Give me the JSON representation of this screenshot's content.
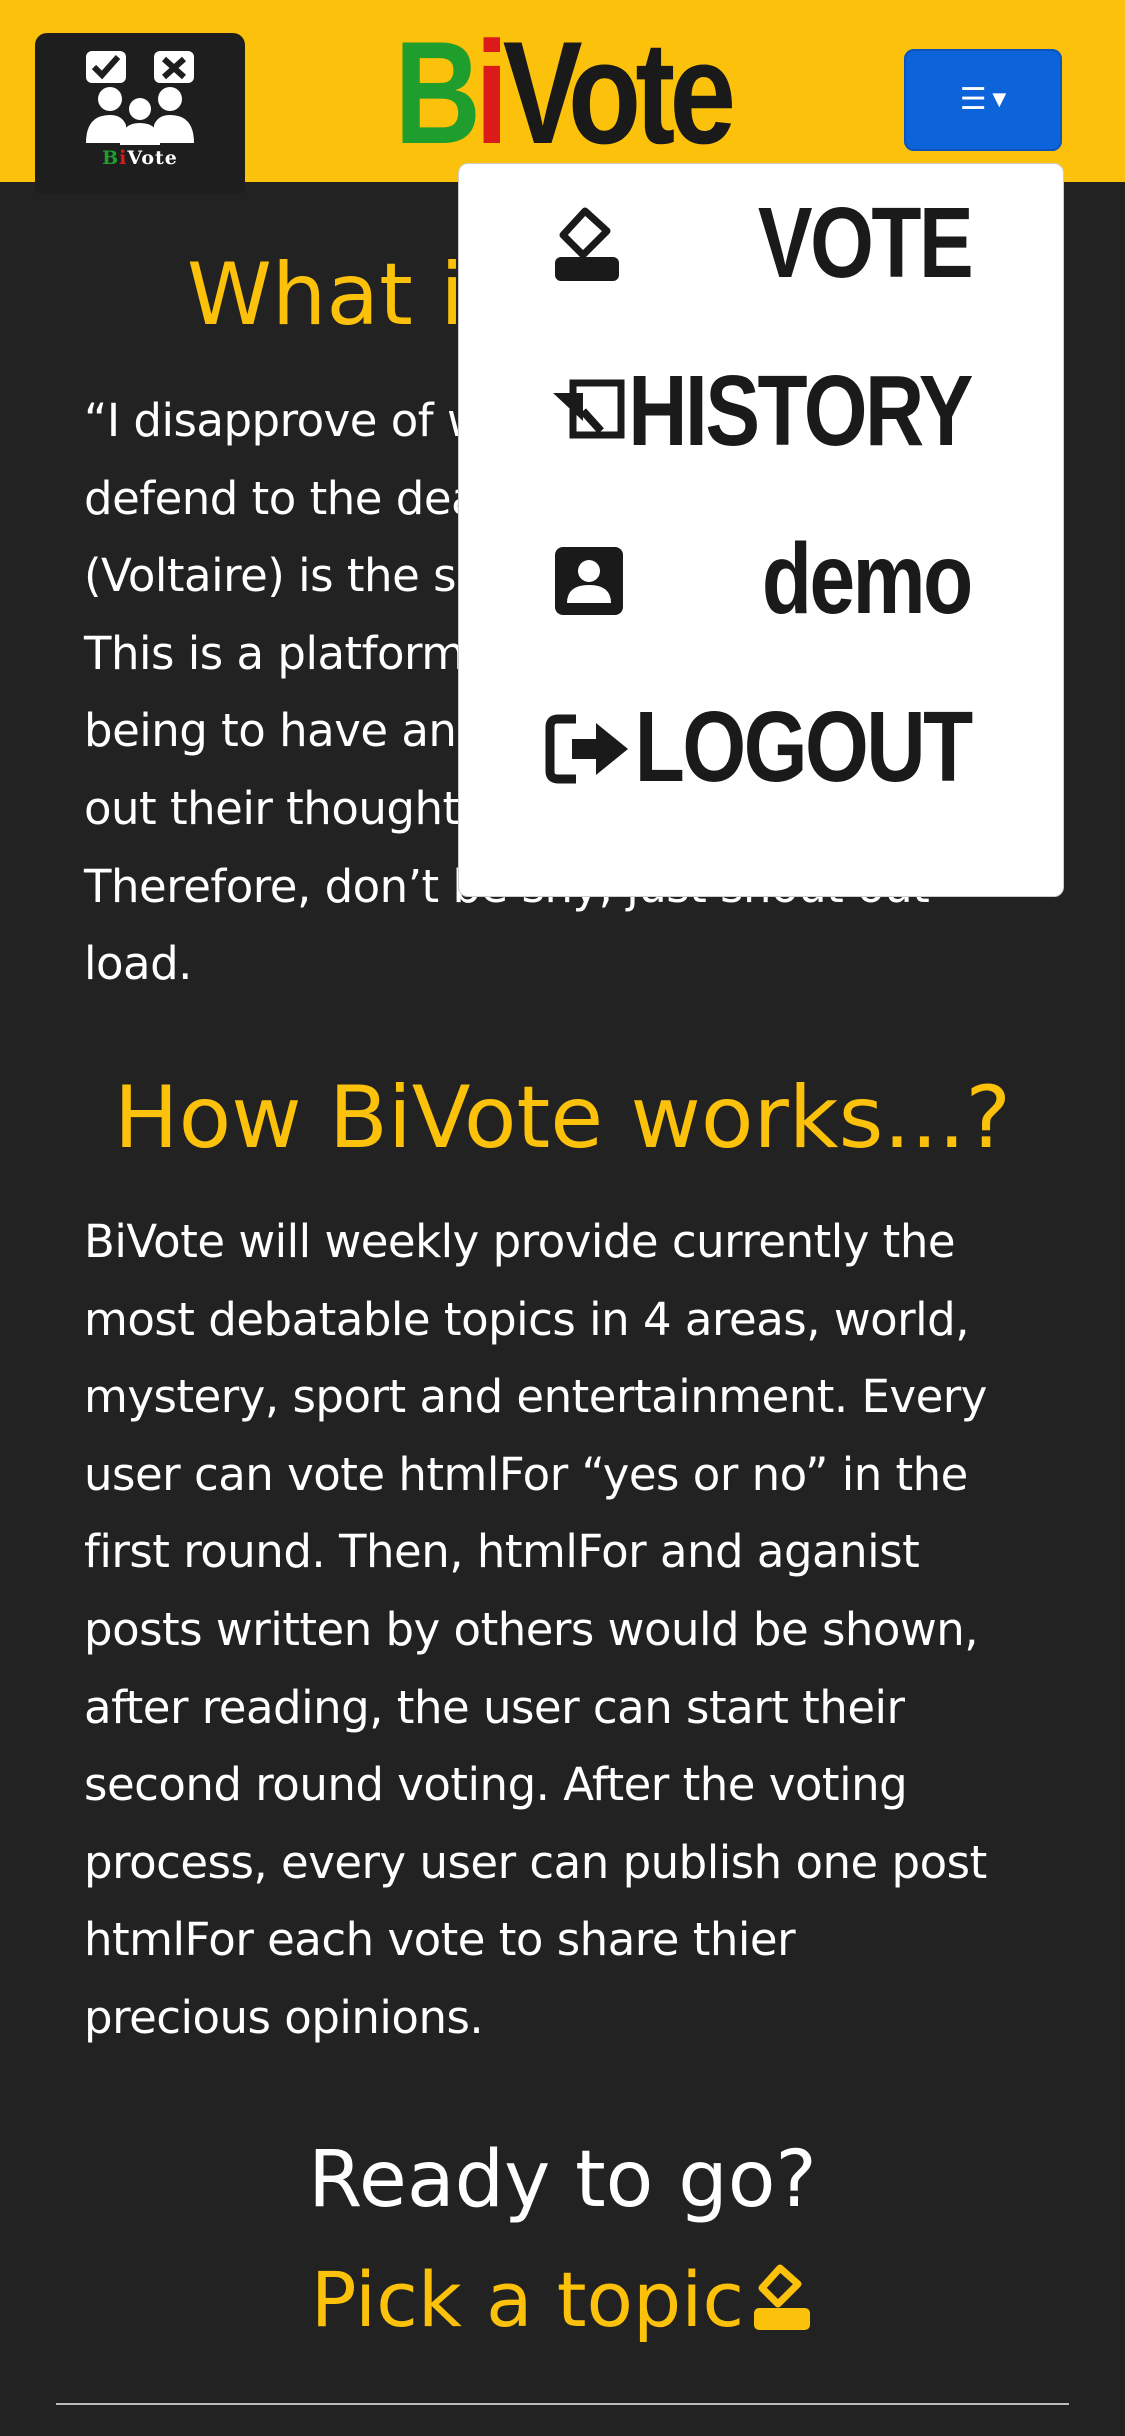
{
  "header": {
    "logo_mini_b": "B",
    "logo_mini_i": "i",
    "logo_mini_rest": "Vote",
    "brand_b": "B",
    "brand_i": "i",
    "brand_rest": "Vote",
    "menu_icon": "hamburger-icon",
    "colors": {
      "nav_bg": "#fcc10a",
      "toggler": "#0d63d9",
      "brand_green": "#1f9e2d",
      "brand_red": "#dd1a1a"
    }
  },
  "dropdown": {
    "items": [
      {
        "label": "VOTE",
        "icon": "ballot-box-icon"
      },
      {
        "label": "HISTORY",
        "icon": "history-icon"
      },
      {
        "label": "demo",
        "icon": "user-icon"
      },
      {
        "label": "LOGOUT",
        "icon": "logout-icon"
      }
    ]
  },
  "main": {
    "section1_heading": "What is BiVote...?",
    "section1_lines": [
      "“I disapprove of what you say, but I will",
      "defend to the death your right to say it”",
      "(Voltaire) is the spirit of BiVote.",
      "This is a platform that allows every human",
      "being to have an equal right to speak",
      "out their thoughts and opinions freely.",
      "Therefore, don’t be shy, just shout out",
      "load."
    ],
    "section2_heading": "How BiVote works...?",
    "section2_lines": [
      "BiVote will weekly provide currently the",
      "most debatable topics in 4 areas, world,",
      "mystery, sport and entertainment. Every",
      "user can vote htmlFor “yes or no” in the",
      "first round. Then, htmlFor and aganist",
      "posts written by others would be shown,",
      "after reading, the user can start their",
      "second round voting. After the voting",
      "process, every user can publish one post",
      "htmlFor each vote to share thier",
      "precious opinions."
    ],
    "ready_text": "Ready to go?",
    "pick_text": "Pick a topic",
    "pick_icon": "ballot-box-icon",
    "text_color": "#ffffff",
    "accent_color": "#fcc10a",
    "background_color": "#222222"
  }
}
